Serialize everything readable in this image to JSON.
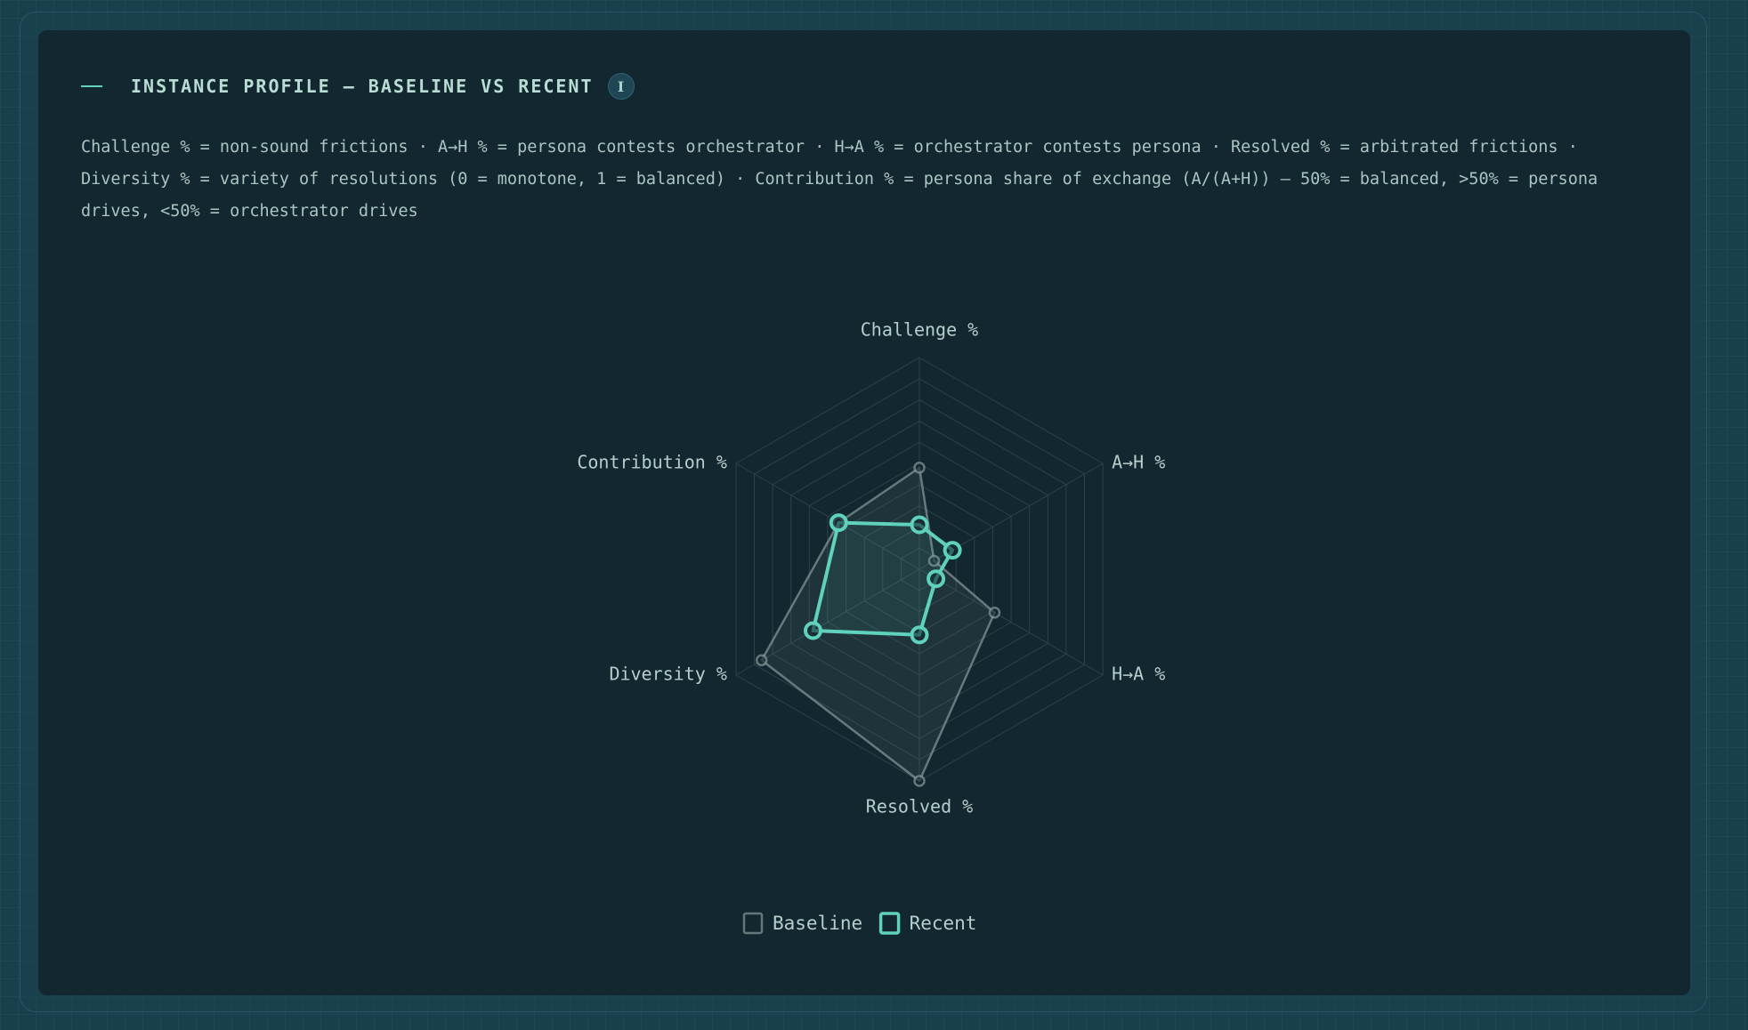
{
  "header": {
    "title": "INSTANCE PROFILE — BASELINE VS RECENT",
    "info_icon_glyph": "I"
  },
  "description": "Challenge % = non-sound frictions · A→H % = persona contests orchestrator · H→A % = orchestrator contests persona · Resolved % = arbitrated frictions · Diversity % = variety of resolutions (0 = monotone, 1 = balanced) · Contribution % = persona share of exchange (A/(A+H)) — 50% = balanced, >50% = persona drives, <50% = orchestrator drives",
  "colors": {
    "accent": "#5fd1bd",
    "baseline": "#8a9a9c",
    "grid": "#2a434b",
    "card_bg": "#12272f",
    "page_bg": "#173f4c"
  },
  "chart_data": {
    "type": "radar",
    "axes": [
      "Challenge %",
      "A→H %",
      "H→A %",
      "Resolved %",
      "Diversity %",
      "Contribution %"
    ],
    "range": [
      0,
      100
    ],
    "grid_levels": 10,
    "grid": true,
    "legend_position": "bottom-center",
    "series": [
      {
        "name": "Baseline",
        "values": [
          48,
          8,
          41,
          100,
          86,
          44
        ]
      },
      {
        "name": "Recent",
        "values": [
          21,
          18,
          9,
          31,
          58,
          44
        ]
      }
    ]
  }
}
